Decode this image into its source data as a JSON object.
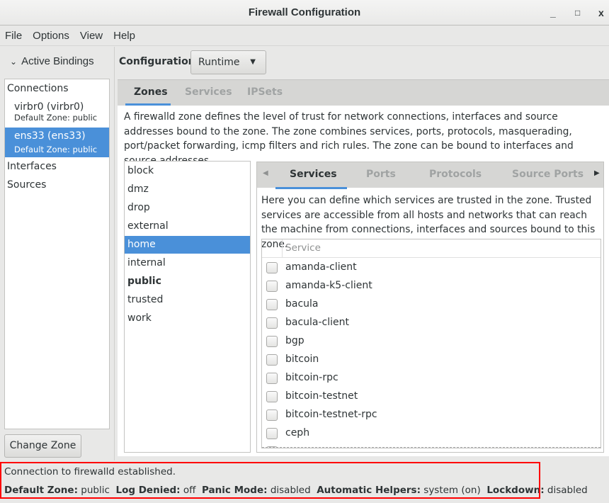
{
  "window": {
    "title": "Firewall Configuration",
    "minimize": "_",
    "maximize": "□",
    "close": "x"
  },
  "menu": [
    "File",
    "Options",
    "View",
    "Help"
  ],
  "left": {
    "header": "Active Bindings",
    "connections_label": "Connections",
    "connections": [
      {
        "name": "virbr0 (virbr0)",
        "zone": "Default Zone: public"
      },
      {
        "name": "ens33 (ens33)",
        "zone": "Default Zone: public",
        "selected": true
      }
    ],
    "interfaces_label": "Interfaces",
    "sources_label": "Sources",
    "change_zone": "Change Zone"
  },
  "config": {
    "label": "Configuration:",
    "value": "Runtime"
  },
  "tabs": [
    "Zones",
    "Services",
    "IPSets"
  ],
  "zones_description": "A firewalld zone defines the level of trust for network connections, interfaces and source addresses bound to the zone. The zone combines services, ports, protocols, masquerading, port/packet forwarding, icmp filters and rich rules. The zone can be bound to interfaces and source addresses.",
  "zones": [
    "block",
    "dmz",
    "drop",
    "external",
    "home",
    "internal",
    "public",
    "trusted",
    "work"
  ],
  "selected_zone": "home",
  "default_zone_bold": "public",
  "zone_tabs": [
    "Services",
    "Ports",
    "Protocols",
    "Source Ports"
  ],
  "services_description": "Here you can define which services are trusted in the zone. Trusted services are accessible from all hosts and networks that can reach the machine from connections, interfaces and sources bound to this zone.",
  "service_header": "Service",
  "services": [
    "amanda-client",
    "amanda-k5-client",
    "bacula",
    "bacula-client",
    "bgp",
    "bitcoin",
    "bitcoin-rpc",
    "bitcoin-testnet",
    "bitcoin-testnet-rpc",
    "ceph"
  ],
  "status": {
    "message": "Connection to firewalld established.",
    "default_zone_label": "Default Zone:",
    "default_zone": "public",
    "log_denied_label": "Log Denied:",
    "log_denied": "off",
    "panic_label": "Panic Mode:",
    "panic": "disabled",
    "helpers_label": "Automatic Helpers:",
    "helpers": "system (on)",
    "lockdown_label": "Lockdown:",
    "lockdown": "disabled"
  },
  "colors": {
    "accent": "#4a90d9",
    "annotation": "#ff0000"
  }
}
